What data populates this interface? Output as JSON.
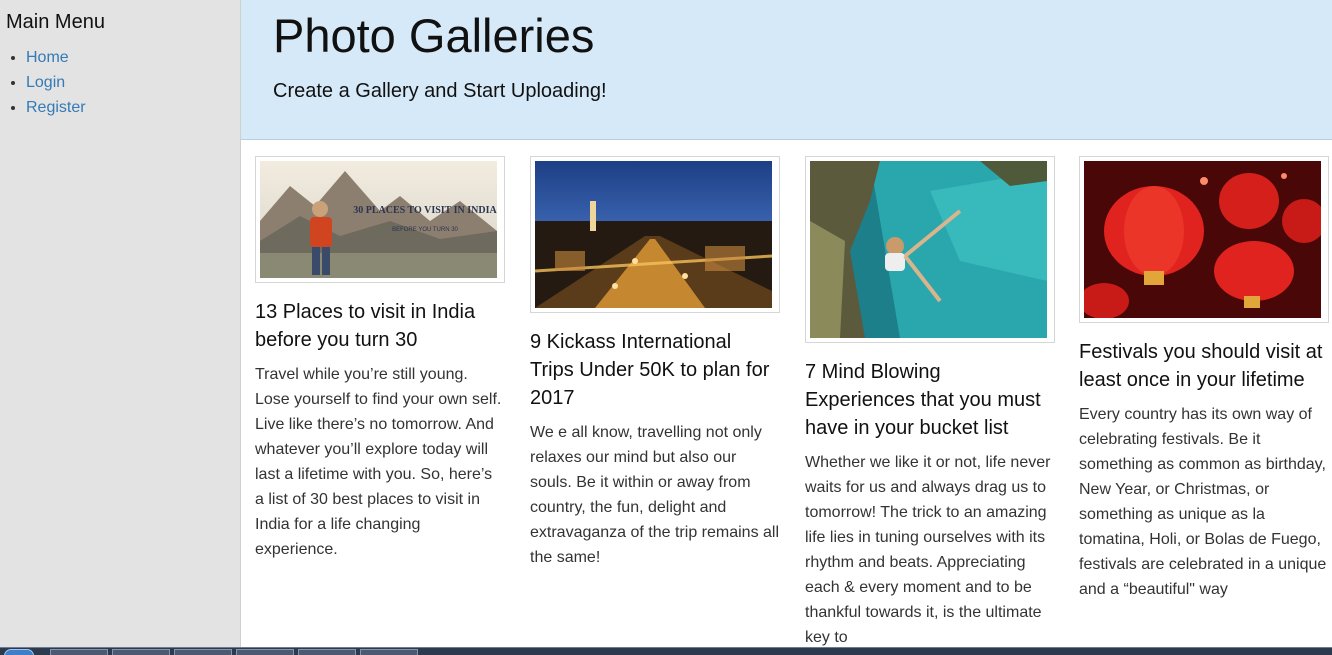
{
  "sidebar": {
    "title": "Main Menu",
    "items": [
      {
        "label": "Home"
      },
      {
        "label": "Login"
      },
      {
        "label": "Register"
      }
    ]
  },
  "header": {
    "title": "Photo Galleries",
    "subtitle": "Create a Gallery and Start Uploading!"
  },
  "galleries": [
    {
      "title": "13 Places to visit in India before you turn 30",
      "description": "Travel while you’re still young. Lose yourself to find your own self. Live like there’s no tomorrow. And whatever you’ll explore today will last a lifetime with you. So, here’s a list of 30 best places to visit in India for a life changing experience.",
      "image_text": "30 PLACES TO VISIT IN INDIA",
      "image_subtext": "BEFORE YOU TURN 30"
    },
    {
      "title": "9 Kickass International Trips Under 50K to plan for 2017",
      "description": "We e all know, travelling not only relaxes our mind but also our souls. Be it within or away from country, the fun, delight and extravaganza of the trip remains all the same!"
    },
    {
      "title": "7 Mind Blowing Experiences that you must have in your bucket list",
      "description": "Whether we like it or not, life never waits for us and always drag us to tomorrow! The trick to an amazing life lies in tuning ourselves with its rhythm and beats. Appreciating each & every moment and to be thankful towards it, is the ultimate key to"
    },
    {
      "title": "Festivals you should visit at least once in your lifetime",
      "description": "Every country has its own way of celebrating festivals. Be it something as common as birthday, New Year, or Christmas, or something as unique as la tomatina, Holi, or Bolas de Fuego, festivals are celebrated in a unique and a “beautiful\" way"
    }
  ],
  "colors": {
    "sidebar_bg": "#e3e3e3",
    "header_bg": "#d6e9f8",
    "link": "#337ab7",
    "taskbar": "#2c3a4e"
  }
}
